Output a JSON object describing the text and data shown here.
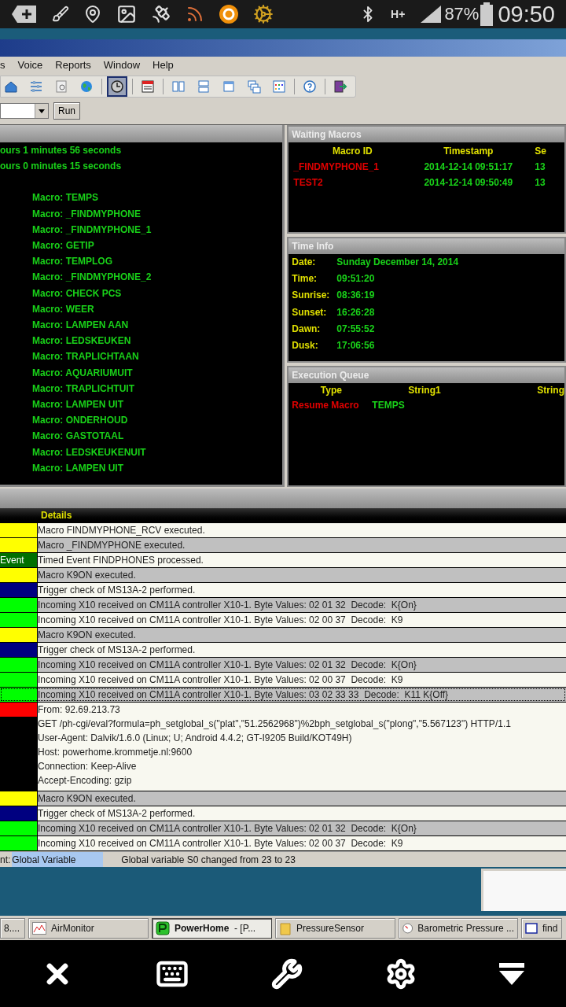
{
  "status_bar": {
    "network": "H+",
    "battery": "87%",
    "time": "09:50"
  },
  "menu": [
    "s",
    "Voice",
    "Reports",
    "Window",
    "Help"
  ],
  "toolbar": {
    "groups": [
      [
        {
          "kind": "house",
          "pressed": false
        },
        {
          "kind": "sliders",
          "pressed": false
        },
        {
          "kind": "document",
          "pressed": false
        },
        {
          "kind": "globe",
          "pressed": false
        }
      ],
      [
        {
          "kind": "clock",
          "pressed": true
        }
      ],
      [
        {
          "kind": "editor",
          "pressed": false
        }
      ],
      [
        {
          "kind": "columns",
          "pressed": false
        },
        {
          "kind": "rows",
          "pressed": false
        },
        {
          "kind": "window",
          "pressed": false
        },
        {
          "kind": "cascade",
          "pressed": false
        },
        {
          "kind": "grid",
          "pressed": false
        }
      ],
      [
        {
          "kind": "help",
          "pressed": false
        }
      ],
      [
        {
          "kind": "exit",
          "pressed": false
        }
      ]
    ]
  },
  "macro_runner": {
    "button": "Run"
  },
  "status_panel": {
    "uptime_lines": [
      "ours 1 minutes 56 seconds",
      "ours 0 minutes 15 seconds"
    ],
    "macros": [
      "Macro: TEMPS",
      "Macro: _FINDMYPHONE",
      "Macro: _FINDMYPHONE_1",
      "Macro: GETIP",
      "Macro: TEMPLOG",
      "Macro: _FINDMYPHONE_2",
      "Macro: CHECK PCS",
      "Macro: WEER",
      "Macro: LAMPEN AAN",
      "Macro: LEDSKEUKEN",
      "Macro: TRAPLICHTAAN",
      "Macro: AQUARIUMUIT",
      "Macro: TRAPLICHTUIT",
      "Macro: LAMPEN UIT",
      "Macro: ONDERHOUD",
      "Macro: GASTOTAAL",
      "Macro: LEDSKEUKENUIT",
      "Macro: LAMPEN UIT"
    ]
  },
  "waiting_macros": {
    "title": "Waiting Macros",
    "columns": [
      "Macro ID",
      "Timestamp",
      "Se"
    ],
    "rows": [
      {
        "macro_id": "_FINDMYPHONE_1",
        "timestamp": "2014-12-14 09:51:17",
        "column_3": "13"
      },
      {
        "macro_id": "TEST2",
        "timestamp": "2014-12-14 09:50:49",
        "column_3": "13"
      }
    ]
  },
  "time_info": {
    "title": "Time Info",
    "rows": [
      {
        "label": "Date:",
        "value": "Sunday December 14, 2014"
      },
      {
        "label": "Time:",
        "value": "09:51:20"
      },
      {
        "label": "Sunrise:",
        "value": "08:36:19"
      },
      {
        "label": "Sunset:",
        "value": "16:26:28"
      },
      {
        "label": "Dawn:",
        "value": "07:55:52"
      },
      {
        "label": "Dusk:",
        "value": "17:06:56"
      }
    ]
  },
  "execution_queue": {
    "title": "Execution Queue",
    "columns": [
      "Type",
      "String1",
      "String"
    ],
    "rows": [
      {
        "type": "Resume Macro",
        "string1": "TEMPS"
      }
    ]
  },
  "log": {
    "columns": [
      "Details"
    ],
    "rows": [
      {
        "color": "#ffff00",
        "selected": false,
        "details": [
          "Macro FINDMYPHONE_RCV executed."
        ]
      },
      {
        "color": "#ffff00",
        "selected": false,
        "details": [
          "Macro _FINDMYPHONE executed."
        ]
      },
      {
        "color": "#007000",
        "label": "Event",
        "selected": false,
        "details": [
          "Timed Event FINDPHONES processed."
        ]
      },
      {
        "color": "#ffff00",
        "selected": false,
        "details": [
          "Macro K9ON executed."
        ]
      },
      {
        "color": "#000080",
        "selected": false,
        "details": [
          "Trigger check of MS13A-2 performed."
        ]
      },
      {
        "color": "#00ff00",
        "selected": false,
        "details": [
          "Incoming X10 received on CM11A controller X10-1. Byte Values: 02 01 32  Decode:  K{On}"
        ]
      },
      {
        "color": "#00ff00",
        "selected": false,
        "details": [
          "Incoming X10 received on CM11A controller X10-1. Byte Values: 02 00 37  Decode:  K9"
        ]
      },
      {
        "color": "#ffff00",
        "selected": false,
        "details": [
          "Macro K9ON executed."
        ]
      },
      {
        "color": "#000080",
        "selected": false,
        "details": [
          "Trigger check of MS13A-2 performed."
        ]
      },
      {
        "color": "#00ff00",
        "selected": false,
        "details": [
          "Incoming X10 received on CM11A controller X10-1. Byte Values: 02 01 32  Decode:  K{On}"
        ]
      },
      {
        "color": "#00ff00",
        "selected": false,
        "details": [
          "Incoming X10 received on CM11A controller X10-1. Byte Values: 02 00 37  Decode:  K9"
        ]
      },
      {
        "color": "#00ff00",
        "selected": true,
        "details": [
          "Incoming X10 received on CM11A controller X10-1. Byte Values: 03 02 33 33  Decode:  K11 K{Off}"
        ]
      },
      {
        "color": "#ff0000",
        "selected": false,
        "details": [
          "From: 92.69.213.73",
          "GET /ph-cgi/eval?formula=ph_setglobal_s(\"plat\",\"51.2562968\")%2bph_setglobal_s(\"plong\",\"5.567123\") HTTP/1.1",
          "User-Agent: Dalvik/1.6.0 (Linux; U; Android 4.4.2; GT-I9205 Build/KOT49H)",
          "Host: powerhome.krommetje.nl:9600",
          "Connection: Keep-Alive",
          "Accept-Encoding: gzip"
        ]
      },
      {
        "color": "#ffff00",
        "selected": false,
        "details": [
          "Macro K9ON executed."
        ]
      },
      {
        "color": "#000080",
        "selected": false,
        "details": [
          "Trigger check of MS13A-2 performed."
        ]
      },
      {
        "color": "#00ff00",
        "selected": false,
        "details": [
          "Incoming X10 received on CM11A controller X10-1. Byte Values: 02 01 32  Decode:  K{On}"
        ]
      },
      {
        "color": "#00ff00",
        "selected": false,
        "details": [
          "Incoming X10 received on CM11A controller X10-1. Byte Values: 02 00 37  Decode:  K9"
        ]
      }
    ]
  },
  "status_line": {
    "label": "nt:",
    "value": "Global Variable",
    "message": "Global variable S0 changed from 23 to 23"
  },
  "taskbar": {
    "items": [
      {
        "kind": "none",
        "label": "8....",
        "selected": false
      },
      {
        "kind": "chart",
        "label": "AirMonitor",
        "selected": false
      },
      {
        "kind": "app",
        "label": "**PowerHome**  - [P...",
        "selected": true
      },
      {
        "kind": "folder",
        "label": "PressureSensor",
        "selected": false
      },
      {
        "kind": "gauge",
        "label": "Barometric Pressure ...",
        "selected": false
      },
      {
        "kind": "window",
        "label": "find",
        "selected": false
      }
    ]
  }
}
